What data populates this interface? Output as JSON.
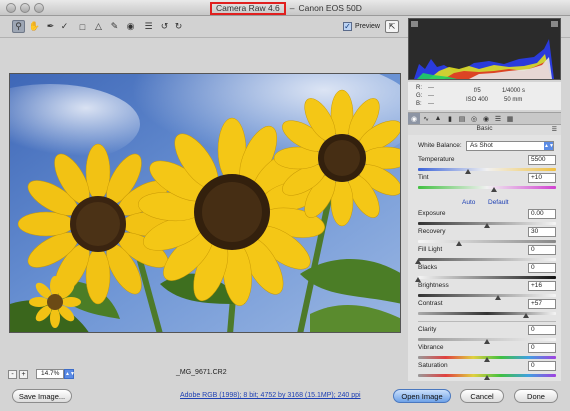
{
  "window": {
    "title_app": "Camera Raw 4.6",
    "title_sep": "–",
    "title_camera": "Canon EOS 50D"
  },
  "toolbar": {
    "tools": [
      "zoom-icon",
      "hand-icon",
      "eyedropper-icon",
      "color-sampler-icon",
      "crop-icon",
      "straighten-icon",
      "retouch-icon",
      "red-eye-icon",
      "preferences-icon",
      "rotate-left-icon",
      "rotate-right-icon"
    ],
    "preview_label": "Preview",
    "preview_checked": true
  },
  "histogram": {
    "r_label": "R:",
    "g_label": "G:",
    "b_label": "B:",
    "r_value": "---",
    "g_value": "---",
    "b_value": "---",
    "aperture": "f/5",
    "shutter": "1/4000 s",
    "iso": "ISO 400",
    "focal": "50 mm"
  },
  "panel": {
    "section_title": "Basic",
    "white_balance_label": "White Balance:",
    "white_balance_value": "As Shot",
    "auto_label": "Auto",
    "default_label": "Default",
    "controls": [
      {
        "id": "temperature",
        "label": "Temperature",
        "value": "5500",
        "level": 0.36
      },
      {
        "id": "tint",
        "label": "Tint",
        "value": "+10",
        "level": 0.55
      },
      {
        "id": "exposure",
        "label": "Exposure",
        "value": "0.00",
        "level": 0.5
      },
      {
        "id": "recovery",
        "label": "Recovery",
        "value": "30",
        "level": 0.3
      },
      {
        "id": "fill_light",
        "label": "Fill Light",
        "value": "0",
        "level": 0.0
      },
      {
        "id": "blacks",
        "label": "Blacks",
        "value": "0",
        "level": 0.0
      },
      {
        "id": "brightness",
        "label": "Brightness",
        "value": "+16",
        "level": 0.58
      },
      {
        "id": "contrast",
        "label": "Contrast",
        "value": "+57",
        "level": 0.78
      },
      {
        "id": "clarity",
        "label": "Clarity",
        "value": "0",
        "level": 0.5
      },
      {
        "id": "vibrance",
        "label": "Vibrance",
        "value": "0",
        "level": 0.5
      },
      {
        "id": "saturation",
        "label": "Saturation",
        "value": "0",
        "level": 0.5
      }
    ]
  },
  "bottom": {
    "zoom_value": "14.7%",
    "filename": "_MG_9671.CR2",
    "workflow_link": "Adobe RGB (1998); 8 bit; 4752 by 3168 (15.1MP); 240 ppi",
    "save_label": "Save Image...",
    "open_label": "Open Image",
    "cancel_label": "Cancel",
    "done_label": "Done"
  },
  "colors": {
    "accent": "#5b8be4",
    "title_highlight": "#e0201f",
    "link": "#1d3fb3"
  }
}
